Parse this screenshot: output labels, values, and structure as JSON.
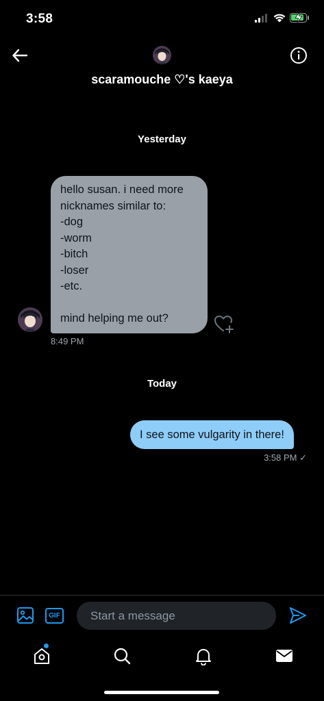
{
  "status_bar": {
    "time": "3:58"
  },
  "header": {
    "title": "scaramouche ♡'s kaeya"
  },
  "conversation": {
    "day_separators": [
      "Yesterday",
      "Today"
    ],
    "received": {
      "text": "hello susan. i need more\nnicknames similar to:\n-dog\n-worm\n-bitch\n-loser\n-etc.\n\nmind helping me out?",
      "timestamp": "8:49 PM"
    },
    "sent": {
      "text": "I see some vulgarity in there!",
      "timestamp": "3:58 PM ✓"
    }
  },
  "composer": {
    "placeholder": "Start a message",
    "gif_label": "GIF"
  },
  "icons": {
    "back": "arrow-left-icon",
    "info": "info-icon",
    "media": "image-icon",
    "gif": "gif-icon",
    "send": "send-icon",
    "react": "heart-plus-icon",
    "nav": [
      "home-icon",
      "search-icon",
      "bell-icon",
      "mail-icon"
    ]
  },
  "colors": {
    "background": "#000000",
    "accent": "#1d9bf0",
    "received_bubble": "#9aa0a8",
    "sent_bubble": "#8ecdf8"
  }
}
